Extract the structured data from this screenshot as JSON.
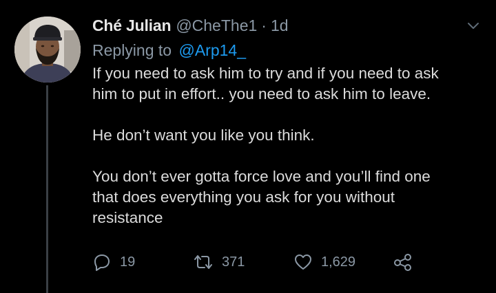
{
  "tweet": {
    "author": {
      "name": "Ché Julian",
      "handle": "@CheThe1",
      "separator": "·",
      "age": "1d"
    },
    "reply_to": {
      "prefix": "Replying to",
      "handle": "@Arp14_"
    },
    "paragraphs": [
      "If you need to ask him to try and if you need to ask\nhim to put in effort.. you need to ask him to leave.",
      "He don’t want you like you think.",
      "You don’t ever gotta force love and you’ll find one\nthat does everything you ask for you without\nresistance"
    ],
    "actions": {
      "replies": "19",
      "retweets": "371",
      "likes": "1,629"
    },
    "icons": [
      "reply-icon",
      "retweet-icon",
      "like-icon",
      "share-icon",
      "chevron-down-icon"
    ],
    "colors": {
      "background": "#000000",
      "text": "#dcdcdc",
      "muted": "#8b98a5",
      "link": "#1d9bf0"
    }
  }
}
